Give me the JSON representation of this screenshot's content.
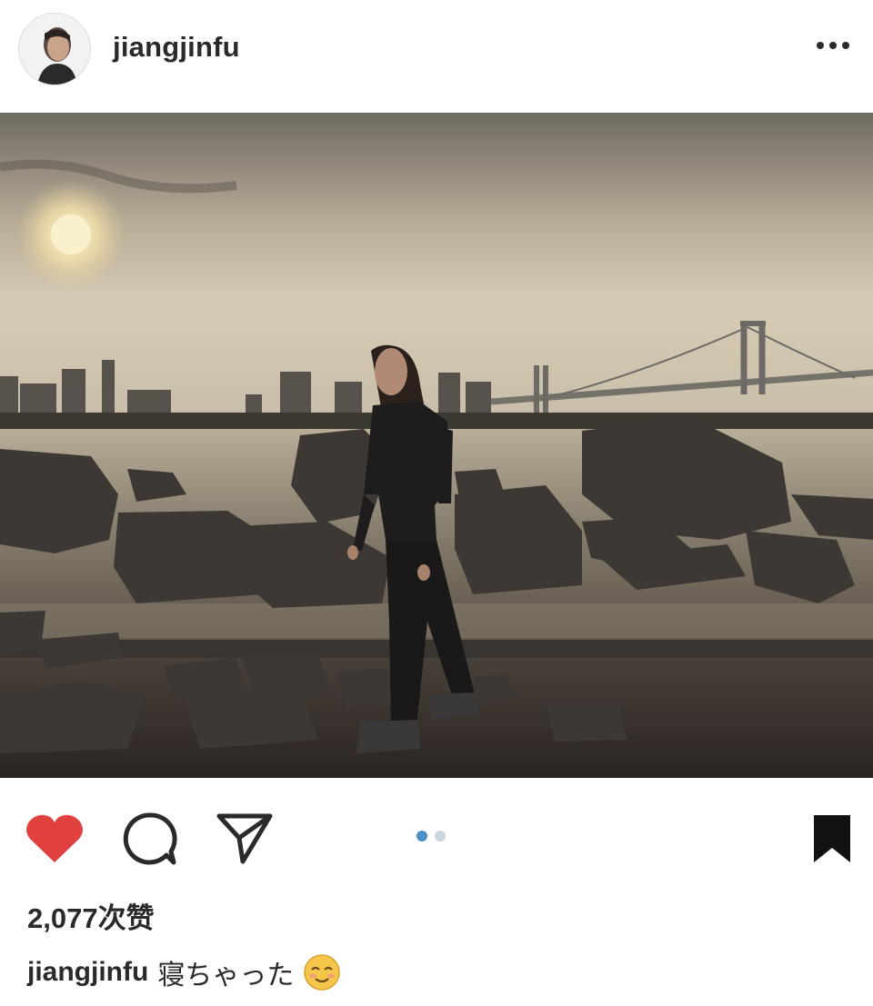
{
  "post": {
    "username": "jiangjinfu",
    "likes_text": "2,077次赞",
    "caption_user": "jiangjinfu",
    "caption_text": "寝ちゃった",
    "caption_emoji": "relieved-face-emoji",
    "carousel": {
      "total": 2,
      "current": 1
    }
  },
  "icons": {
    "more": "more-options-icon",
    "like": "heart-icon",
    "comment": "comment-bubble-icon",
    "share": "send-icon",
    "save": "bookmark-icon"
  },
  "colors": {
    "like_red": "#e0413f",
    "carousel_active": "#4b90c9",
    "carousel_inactive": "#c9d6e0",
    "text": "#2a2a2a"
  }
}
